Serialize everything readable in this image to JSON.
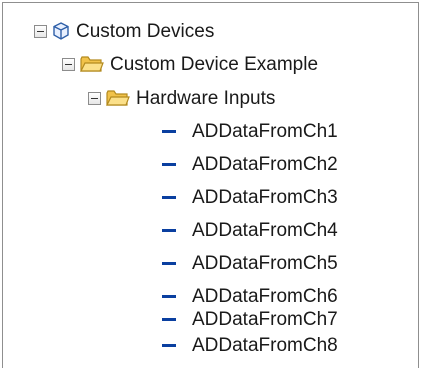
{
  "tree": {
    "root": {
      "label": "Custom Devices",
      "icon": "cube-icon",
      "expanded": true,
      "children": [
        {
          "label": "Custom Device Example",
          "icon": "folder-icon",
          "expanded": true,
          "children": [
            {
              "label": "Hardware Inputs",
              "icon": "folder-icon",
              "expanded": true,
              "channels": [
                "ADDataFromCh1",
                "ADDataFromCh2",
                "ADDataFromCh3",
                "ADDataFromCh4",
                "ADDataFromCh5",
                "ADDataFromCh6",
                "ADDataFromCh7",
                "ADDataFromCh8"
              ]
            }
          ]
        }
      ]
    }
  },
  "colors": {
    "channel_marker": "#0a3fa0",
    "folder_fill": "#f7d26b",
    "folder_stroke": "#b38a1f",
    "cube_stroke": "#2e5fa8"
  }
}
